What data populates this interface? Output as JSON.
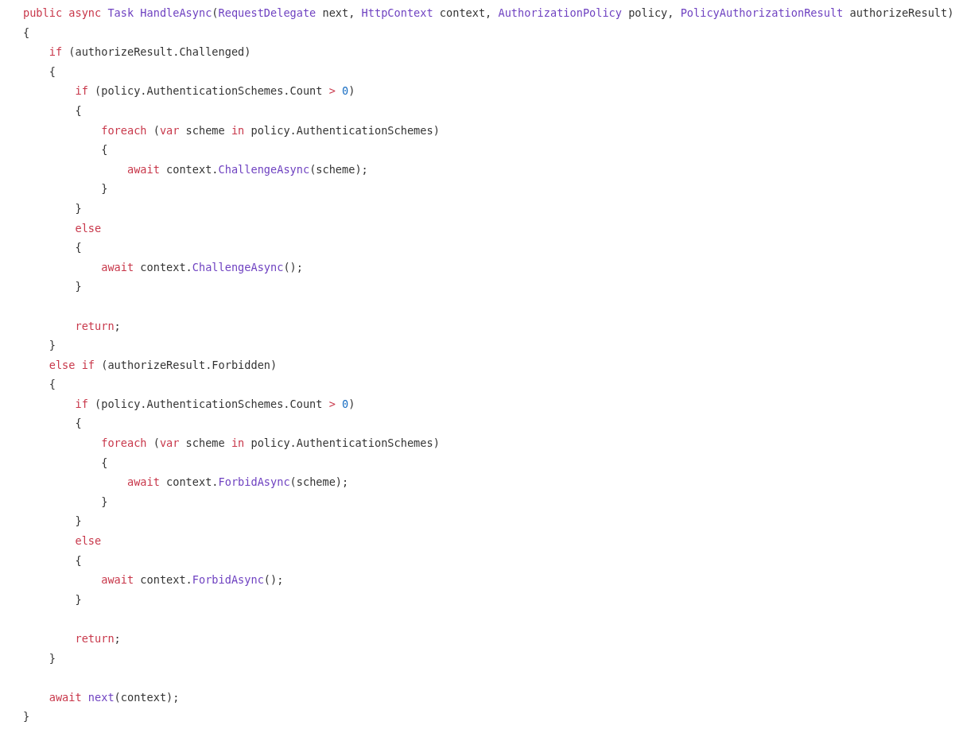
{
  "code_lines": [
    {
      "kind": "code",
      "tokens": [
        {
          "kind": "kw",
          "t": "public"
        },
        {
          "kind": "kw",
          "t": " async"
        },
        {
          "kind": "type",
          "t": " Task"
        },
        {
          "kind": "type",
          "t": " HandleAsync"
        },
        {
          "kind": "plain",
          "t": "("
        },
        {
          "kind": "type",
          "t": "RequestDelegate"
        },
        {
          "kind": "plain",
          "t": " next, "
        },
        {
          "kind": "type",
          "t": "HttpContext"
        },
        {
          "kind": "plain",
          "t": " context, "
        },
        {
          "kind": "type",
          "t": "AuthorizationPolicy"
        },
        {
          "kind": "plain",
          "t": " policy, "
        },
        {
          "kind": "type",
          "t": "PolicyAuthorizationResult"
        },
        {
          "kind": "plain",
          "t": " authorizeResult)"
        }
      ]
    },
    {
      "kind": "code",
      "tokens": [
        {
          "kind": "plain",
          "t": "{"
        }
      ]
    },
    {
      "kind": "code",
      "tokens": [
        {
          "kind": "kw",
          "t": "    if"
        },
        {
          "kind": "plain",
          "t": " (authorizeResult.Challenged)"
        }
      ]
    },
    {
      "kind": "code",
      "tokens": [
        {
          "kind": "plain",
          "t": "    {"
        }
      ]
    },
    {
      "kind": "code",
      "tokens": [
        {
          "kind": "kw",
          "t": "        if"
        },
        {
          "kind": "plain",
          "t": " (policy.AuthenticationSchemes.Count "
        },
        {
          "kind": "kw",
          "t": ">"
        },
        {
          "kind": "num",
          "t": " 0"
        },
        {
          "kind": "plain",
          "t": ")"
        }
      ]
    },
    {
      "kind": "code",
      "tokens": [
        {
          "kind": "plain",
          "t": "        {"
        }
      ]
    },
    {
      "kind": "code",
      "tokens": [
        {
          "kind": "kw",
          "t": "            foreach"
        },
        {
          "kind": "plain",
          "t": " ("
        },
        {
          "kind": "kw",
          "t": "var"
        },
        {
          "kind": "plain",
          "t": " scheme "
        },
        {
          "kind": "kw",
          "t": "in"
        },
        {
          "kind": "plain",
          "t": " policy.AuthenticationSchemes)"
        }
      ]
    },
    {
      "kind": "code",
      "tokens": [
        {
          "kind": "plain",
          "t": "            {"
        }
      ]
    },
    {
      "kind": "code",
      "tokens": [
        {
          "kind": "kw",
          "t": "                await"
        },
        {
          "kind": "plain",
          "t": " context."
        },
        {
          "kind": "type",
          "t": "ChallengeAsync"
        },
        {
          "kind": "plain",
          "t": "(scheme);"
        }
      ]
    },
    {
      "kind": "code",
      "tokens": [
        {
          "kind": "plain",
          "t": "            }"
        }
      ]
    },
    {
      "kind": "code",
      "tokens": [
        {
          "kind": "plain",
          "t": "        }"
        }
      ]
    },
    {
      "kind": "code",
      "tokens": [
        {
          "kind": "kw",
          "t": "        else"
        }
      ]
    },
    {
      "kind": "code",
      "tokens": [
        {
          "kind": "plain",
          "t": "        {"
        }
      ]
    },
    {
      "kind": "code",
      "tokens": [
        {
          "kind": "kw",
          "t": "            await"
        },
        {
          "kind": "plain",
          "t": " context."
        },
        {
          "kind": "type",
          "t": "ChallengeAsync"
        },
        {
          "kind": "plain",
          "t": "();"
        }
      ]
    },
    {
      "kind": "code",
      "tokens": [
        {
          "kind": "plain",
          "t": "        }"
        }
      ]
    },
    {
      "kind": "blank"
    },
    {
      "kind": "code",
      "tokens": [
        {
          "kind": "kw",
          "t": "        return"
        },
        {
          "kind": "plain",
          "t": ";"
        }
      ]
    },
    {
      "kind": "code",
      "tokens": [
        {
          "kind": "plain",
          "t": "    }"
        }
      ]
    },
    {
      "kind": "code",
      "tokens": [
        {
          "kind": "kw",
          "t": "    else"
        },
        {
          "kind": "kw",
          "t": " if"
        },
        {
          "kind": "plain",
          "t": " (authorizeResult.Forbidden)"
        }
      ]
    },
    {
      "kind": "code",
      "tokens": [
        {
          "kind": "plain",
          "t": "    {"
        }
      ]
    },
    {
      "kind": "code",
      "tokens": [
        {
          "kind": "kw",
          "t": "        if"
        },
        {
          "kind": "plain",
          "t": " (policy.AuthenticationSchemes.Count "
        },
        {
          "kind": "kw",
          "t": ">"
        },
        {
          "kind": "num",
          "t": " 0"
        },
        {
          "kind": "plain",
          "t": ")"
        }
      ]
    },
    {
      "kind": "code",
      "tokens": [
        {
          "kind": "plain",
          "t": "        {"
        }
      ]
    },
    {
      "kind": "code",
      "tokens": [
        {
          "kind": "kw",
          "t": "            foreach"
        },
        {
          "kind": "plain",
          "t": " ("
        },
        {
          "kind": "kw",
          "t": "var"
        },
        {
          "kind": "plain",
          "t": " scheme "
        },
        {
          "kind": "kw",
          "t": "in"
        },
        {
          "kind": "plain",
          "t": " policy.AuthenticationSchemes)"
        }
      ]
    },
    {
      "kind": "code",
      "tokens": [
        {
          "kind": "plain",
          "t": "            {"
        }
      ]
    },
    {
      "kind": "code",
      "tokens": [
        {
          "kind": "kw",
          "t": "                await"
        },
        {
          "kind": "plain",
          "t": " context."
        },
        {
          "kind": "type",
          "t": "ForbidAsync"
        },
        {
          "kind": "plain",
          "t": "(scheme);"
        }
      ]
    },
    {
      "kind": "code",
      "tokens": [
        {
          "kind": "plain",
          "t": "            }"
        }
      ]
    },
    {
      "kind": "code",
      "tokens": [
        {
          "kind": "plain",
          "t": "        }"
        }
      ]
    },
    {
      "kind": "code",
      "tokens": [
        {
          "kind": "kw",
          "t": "        else"
        }
      ]
    },
    {
      "kind": "code",
      "tokens": [
        {
          "kind": "plain",
          "t": "        {"
        }
      ]
    },
    {
      "kind": "code",
      "tokens": [
        {
          "kind": "kw",
          "t": "            await"
        },
        {
          "kind": "plain",
          "t": " context."
        },
        {
          "kind": "type",
          "t": "ForbidAsync"
        },
        {
          "kind": "plain",
          "t": "();"
        }
      ]
    },
    {
      "kind": "code",
      "tokens": [
        {
          "kind": "plain",
          "t": "        }"
        }
      ]
    },
    {
      "kind": "blank"
    },
    {
      "kind": "code",
      "tokens": [
        {
          "kind": "kw",
          "t": "        return"
        },
        {
          "kind": "plain",
          "t": ";"
        }
      ]
    },
    {
      "kind": "code",
      "tokens": [
        {
          "kind": "plain",
          "t": "    }"
        }
      ]
    },
    {
      "kind": "blank"
    },
    {
      "kind": "code",
      "tokens": [
        {
          "kind": "kw",
          "t": "    await"
        },
        {
          "kind": "type",
          "t": " next"
        },
        {
          "kind": "plain",
          "t": "(context);"
        }
      ]
    },
    {
      "kind": "code",
      "tokens": [
        {
          "kind": "plain",
          "t": "}"
        }
      ]
    }
  ]
}
